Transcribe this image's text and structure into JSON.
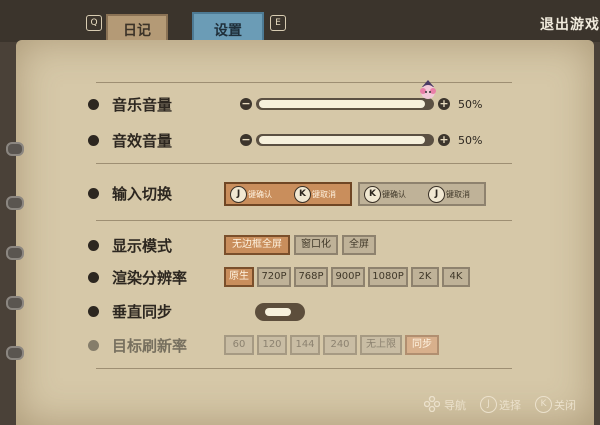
{
  "tabs": {
    "prev_key": "Q",
    "diary_label": "日记",
    "settings_label": "设置",
    "next_key": "E"
  },
  "header": {
    "exit_label": "退出游戏"
  },
  "settings": {
    "music_volume": {
      "label": "音乐音量",
      "value": 50,
      "pct_text": "50%",
      "minus": "−",
      "plus": "+"
    },
    "sfx_volume": {
      "label": "音效音量",
      "value": 50,
      "pct_text": "50%",
      "minus": "−",
      "plus": "+"
    },
    "input_switch": {
      "label": "输入切换",
      "options": [
        {
          "k1": "J",
          "t1": "键确认",
          "k2": "K",
          "t2": "键取消"
        },
        {
          "k1": "K",
          "t1": "键确认",
          "k2": "J",
          "t2": "键取消"
        }
      ],
      "selected_index": 0
    },
    "display_mode": {
      "label": "显示模式",
      "options": [
        "无边框全屏",
        "窗口化",
        "全屏"
      ],
      "selected_index": 0
    },
    "resolution": {
      "label": "渲染分辨率",
      "options": [
        "原生",
        "720P",
        "768P",
        "900P",
        "1080P",
        "2K",
        "4K"
      ],
      "selected_index": 0
    },
    "vsync": {
      "label": "垂直同步",
      "enabled": true
    },
    "refresh_rate": {
      "label": "目标刷新率",
      "options": [
        "60",
        "120",
        "144",
        "240",
        "无上限",
        "同步"
      ],
      "selected_index": 5,
      "disabled": true
    }
  },
  "footer": {
    "nav_label": "导航",
    "select_key": "J",
    "select_label": "选择",
    "close_key": "K",
    "close_label": "关闭"
  },
  "colors": {
    "paper": "#d6c8a8",
    "accent_tab": "#6b9cb6",
    "selected_chip": "#c98e5c"
  }
}
